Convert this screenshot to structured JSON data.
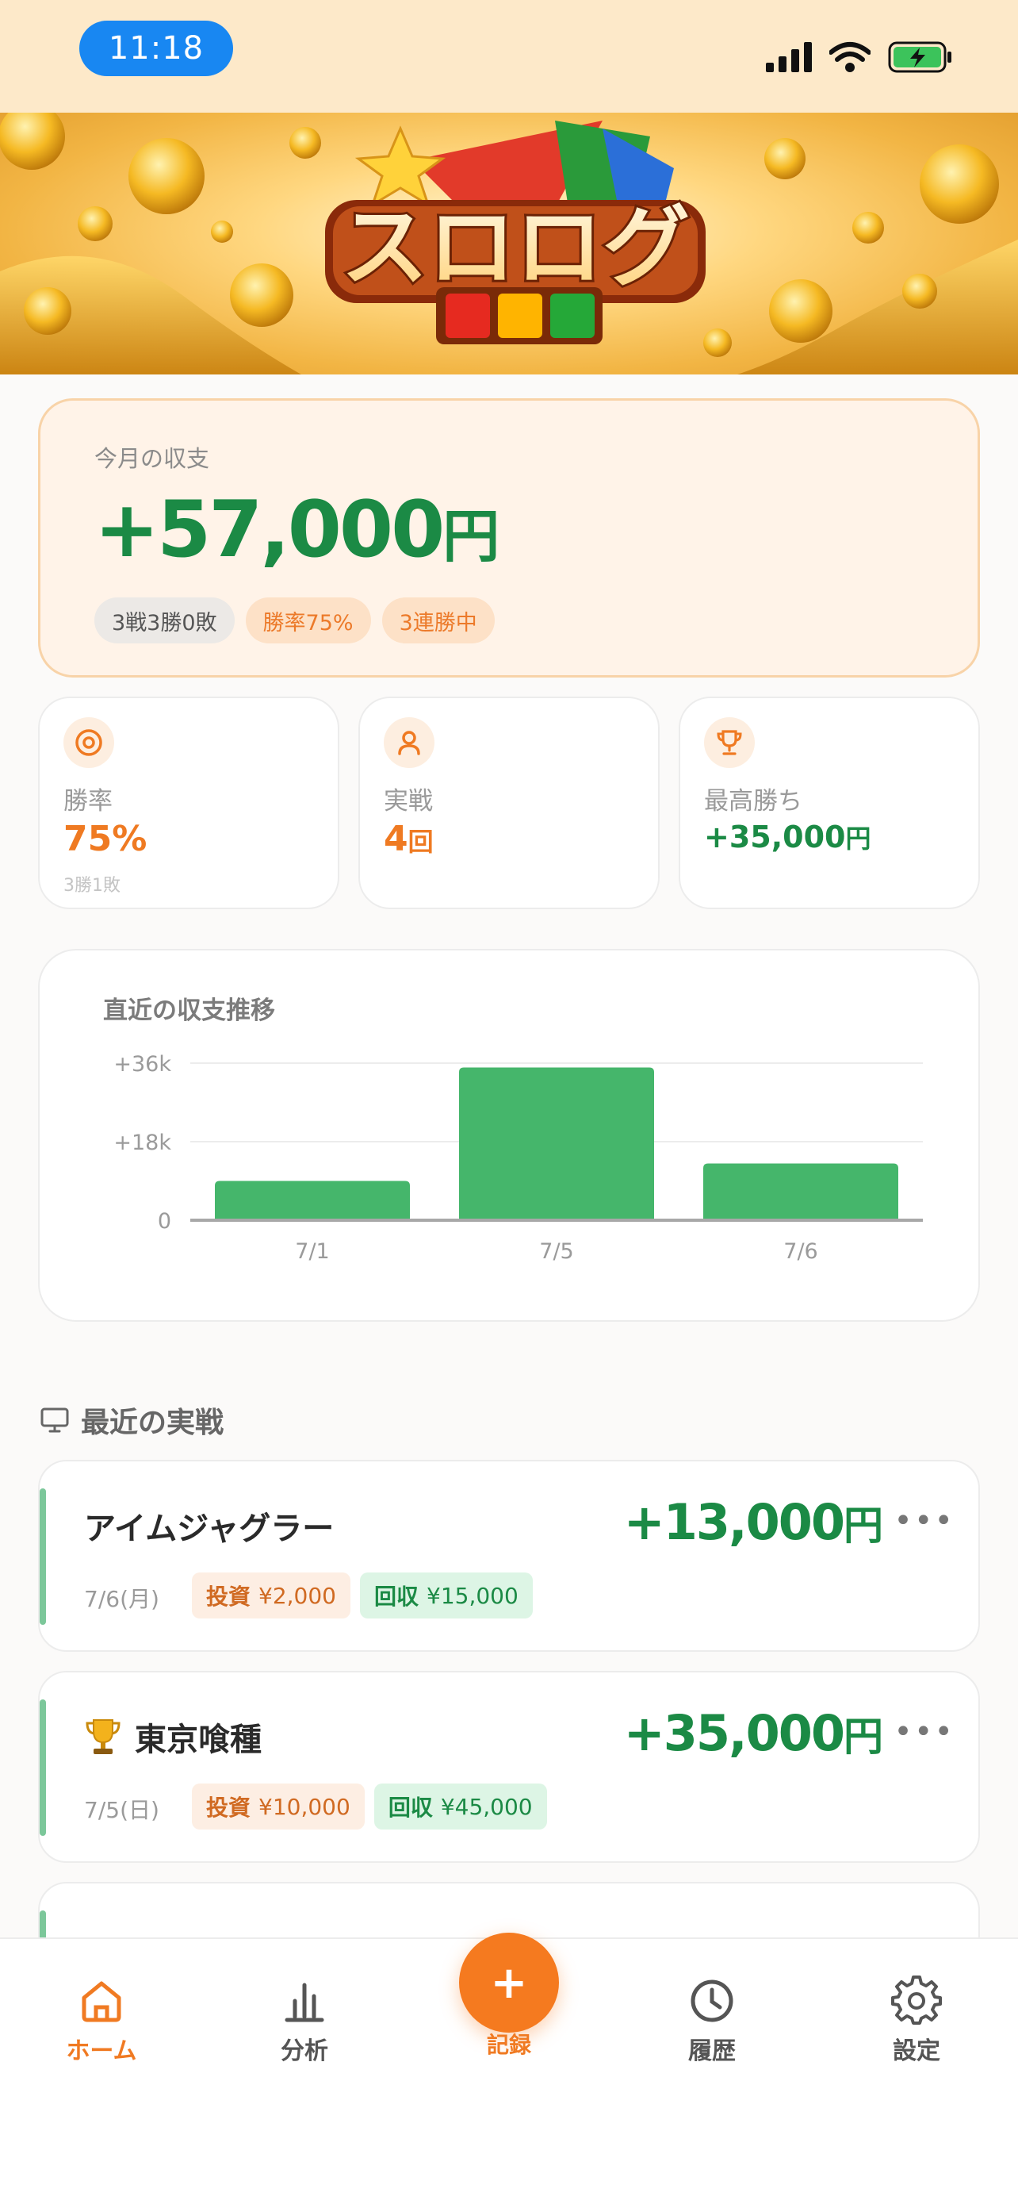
{
  "status_bar": {
    "time": "11:18"
  },
  "banner": {
    "logo_text": "スロログ"
  },
  "month": {
    "label": "今月の収支",
    "amount": "+57,000",
    "currency": "円",
    "chips": [
      "3戦3勝0敗",
      "勝率75%",
      "3連勝中"
    ]
  },
  "stats": [
    {
      "label": "勝率",
      "value": "75",
      "unit": "%",
      "sub": "3勝1敗",
      "icon": "target-icon"
    },
    {
      "label": "実戦",
      "value": "4",
      "unit": "回",
      "sub": "",
      "icon": "user-icon"
    },
    {
      "label": "最高勝ち",
      "value": "+35,000",
      "unit": "円",
      "sub": "",
      "icon": "trophy-icon"
    }
  ],
  "chart_data": {
    "type": "bar",
    "title": "直近の収支推移",
    "categories": [
      "7/1",
      "7/5",
      "7/6"
    ],
    "values": [
      9000,
      35000,
      13000
    ],
    "ylim": [
      0,
      36000
    ],
    "y_ticks": [
      0,
      18000,
      36000
    ],
    "y_tick_labels": [
      "0",
      "+18k",
      "+36k"
    ],
    "grid": true,
    "bar_color": "#45b66b"
  },
  "recent": {
    "title": "最近の実戦",
    "records": [
      {
        "name": "アイムジャグラー",
        "amount": "+13,000",
        "currency": "円",
        "date": "7/6(月)",
        "invest_label": "投資",
        "invest": "¥2,000",
        "return_label": "回収",
        "return": "¥15,000",
        "trophy": false
      },
      {
        "name": "東京喰種",
        "amount": "+35,000",
        "currency": "円",
        "date": "7/5(日)",
        "invest_label": "投資",
        "invest": "¥10,000",
        "return_label": "回収",
        "return": "¥45,000",
        "trophy": true
      }
    ]
  },
  "tabbar": {
    "home": "ホーム",
    "analysis": "分析",
    "record": "記録",
    "history": "履歴",
    "settings": "設定"
  },
  "colors": {
    "accent": "#f57a1f",
    "positive": "#1b8a45",
    "bar": "#45b66b"
  }
}
